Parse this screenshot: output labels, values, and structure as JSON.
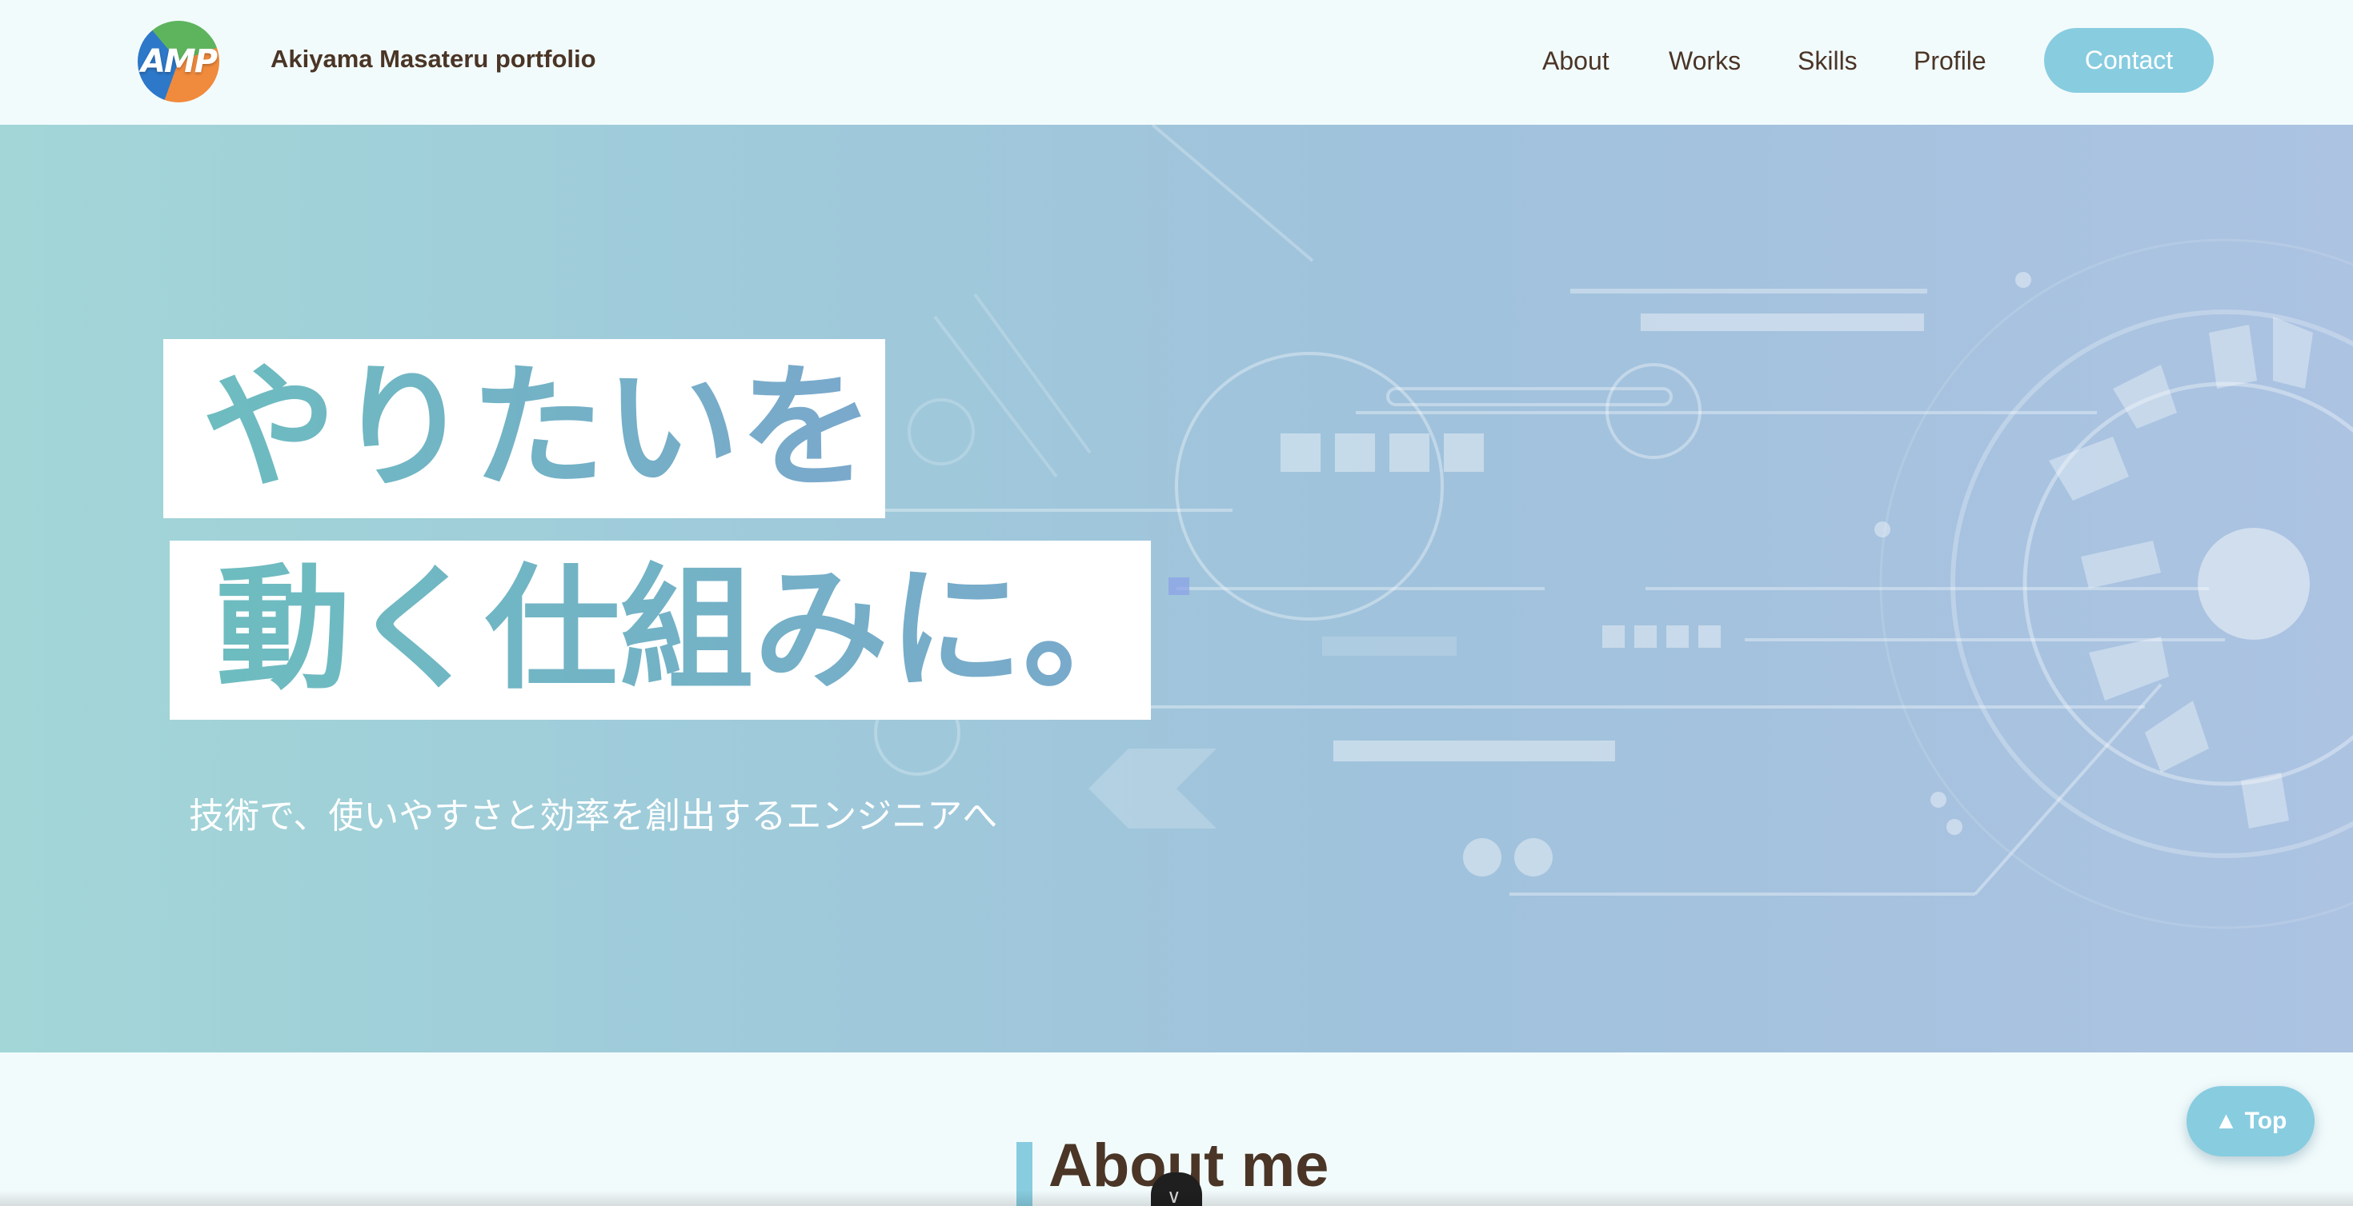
{
  "header": {
    "logo_text": "AMP",
    "site_title": "Akiyama Masateru portfolio",
    "nav": [
      {
        "label": "About"
      },
      {
        "label": "Works"
      },
      {
        "label": "Skills"
      },
      {
        "label": "Profile"
      }
    ],
    "contact_label": "Contact"
  },
  "hero": {
    "headline_line1": "やりたいを",
    "headline_line2": "動く仕組みに。",
    "subline": "技術で、使いやすさと効率を創出するエンジニアへ"
  },
  "about": {
    "title": "About me"
  },
  "scroll_icon": "chevron-down-icon",
  "top_button_label": "▲ Top",
  "colors": {
    "accent": "#88cce0",
    "text": "#4a3526",
    "background": "#f2fbfc"
  }
}
